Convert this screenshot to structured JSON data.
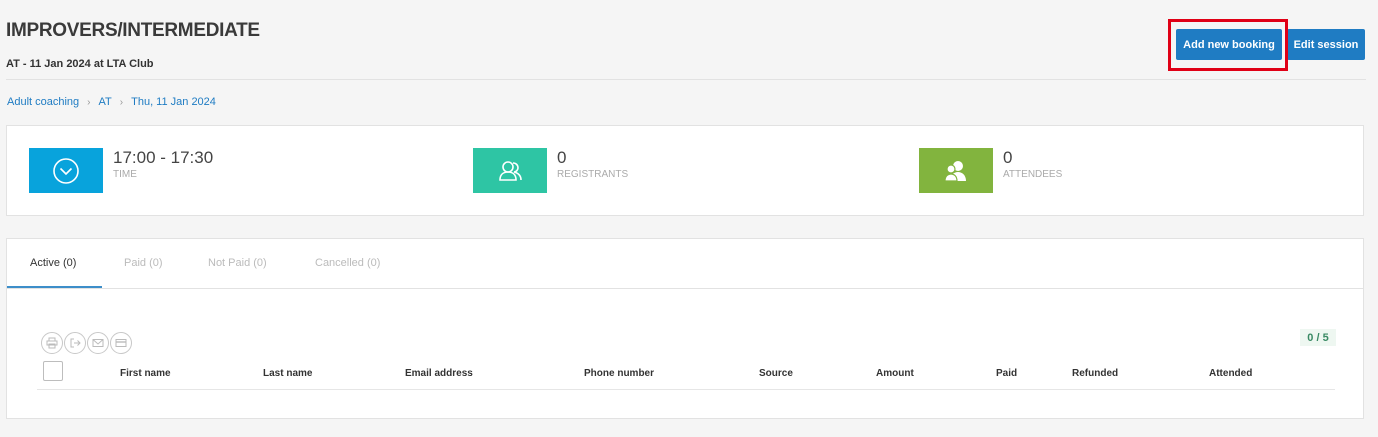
{
  "header": {
    "title": "IMPROVERS/INTERMEDIATE",
    "subtitle": "AT - 11 Jan 2024 at LTA Club",
    "add_booking_label": "Add new booking",
    "edit_session_label": "Edit session"
  },
  "breadcrumb": [
    "Adult coaching",
    "AT",
    "Thu, 11 Jan 2024"
  ],
  "stats": {
    "time": {
      "value": "17:00 - 17:30",
      "label": "TIME",
      "color": "#08a3dc",
      "icon": "clock-icon"
    },
    "registrants": {
      "value": "0",
      "label": "REGISTRANTS",
      "color": "#2ec5a4",
      "icon": "users-icon"
    },
    "attendees": {
      "value": "0",
      "label": "ATTENDEES",
      "color": "#82b43e",
      "icon": "attendees-icon"
    }
  },
  "tabs": [
    "Active (0)",
    "Paid (0)",
    "Not Paid (0)",
    "Cancelled (0)"
  ],
  "toolbar_icons": [
    "print-icon",
    "export-icon",
    "email-icon",
    "payment-icon"
  ],
  "counter": "0 / 5",
  "table": {
    "columns": [
      "First name",
      "Last name",
      "Email address",
      "Phone number",
      "Source",
      "Amount",
      "Paid",
      "Refunded",
      "Attended"
    ]
  }
}
